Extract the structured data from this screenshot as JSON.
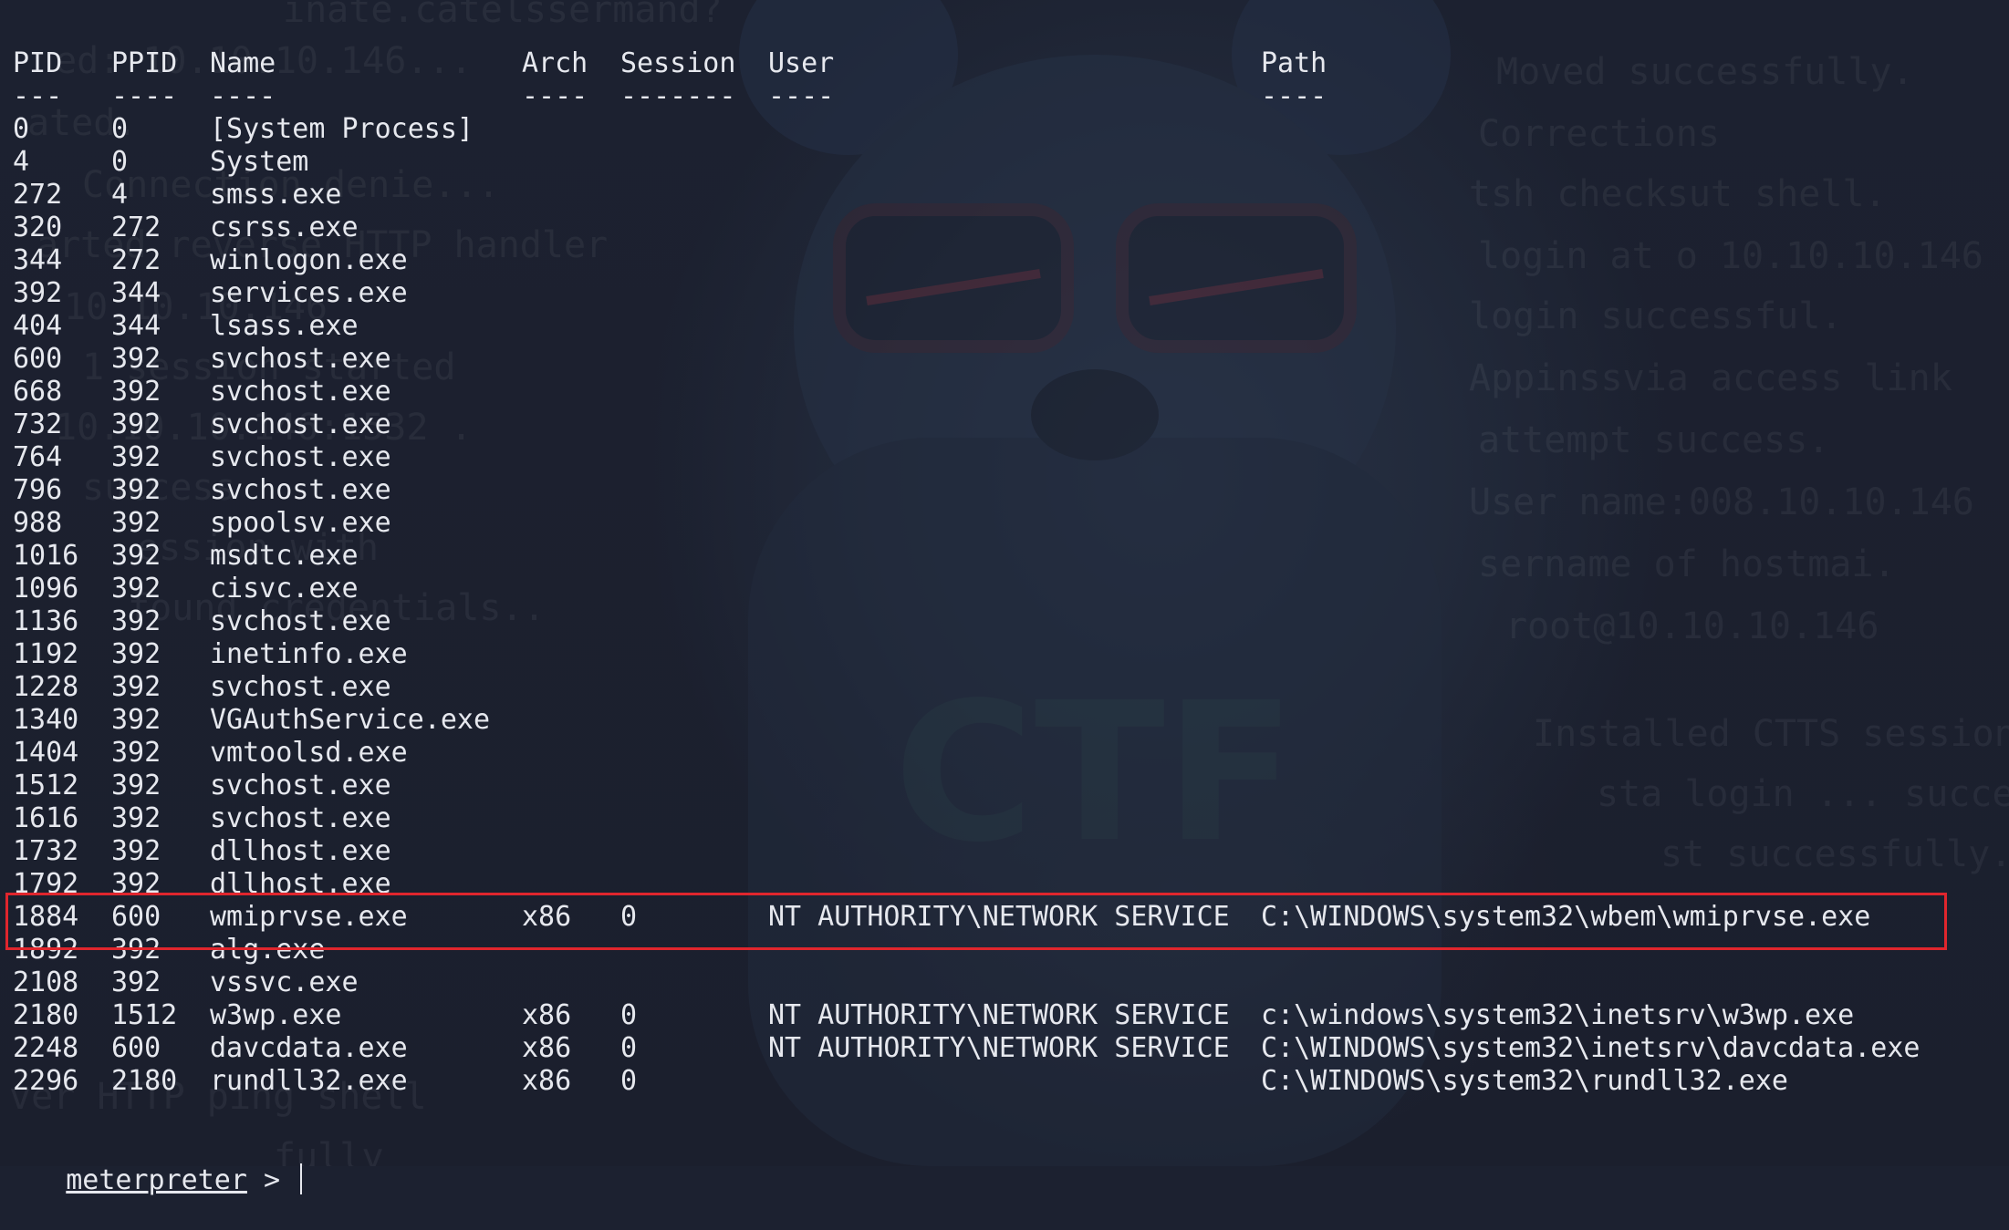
{
  "terminal": {
    "top_rule": "--------------",
    "headers": {
      "pid": "PID",
      "ppid": "PPID",
      "name": "Name",
      "arch": "Arch",
      "session": "Session",
      "user": "User",
      "path": "Path"
    },
    "underlines": {
      "pid": "---",
      "ppid": "----",
      "name": "----",
      "arch": "----",
      "session": "-------",
      "user": "----",
      "path": "----"
    },
    "rows": [
      {
        "pid": "0",
        "ppid": "0",
        "name": "[System Process]",
        "arch": "",
        "session": "",
        "user": "",
        "path": ""
      },
      {
        "pid": "4",
        "ppid": "0",
        "name": "System",
        "arch": "",
        "session": "",
        "user": "",
        "path": ""
      },
      {
        "pid": "272",
        "ppid": "4",
        "name": "smss.exe",
        "arch": "",
        "session": "",
        "user": "",
        "path": ""
      },
      {
        "pid": "320",
        "ppid": "272",
        "name": "csrss.exe",
        "arch": "",
        "session": "",
        "user": "",
        "path": ""
      },
      {
        "pid": "344",
        "ppid": "272",
        "name": "winlogon.exe",
        "arch": "",
        "session": "",
        "user": "",
        "path": ""
      },
      {
        "pid": "392",
        "ppid": "344",
        "name": "services.exe",
        "arch": "",
        "session": "",
        "user": "",
        "path": ""
      },
      {
        "pid": "404",
        "ppid": "344",
        "name": "lsass.exe",
        "arch": "",
        "session": "",
        "user": "",
        "path": ""
      },
      {
        "pid": "600",
        "ppid": "392",
        "name": "svchost.exe",
        "arch": "",
        "session": "",
        "user": "",
        "path": ""
      },
      {
        "pid": "668",
        "ppid": "392",
        "name": "svchost.exe",
        "arch": "",
        "session": "",
        "user": "",
        "path": ""
      },
      {
        "pid": "732",
        "ppid": "392",
        "name": "svchost.exe",
        "arch": "",
        "session": "",
        "user": "",
        "path": ""
      },
      {
        "pid": "764",
        "ppid": "392",
        "name": "svchost.exe",
        "arch": "",
        "session": "",
        "user": "",
        "path": ""
      },
      {
        "pid": "796",
        "ppid": "392",
        "name": "svchost.exe",
        "arch": "",
        "session": "",
        "user": "",
        "path": ""
      },
      {
        "pid": "988",
        "ppid": "392",
        "name": "spoolsv.exe",
        "arch": "",
        "session": "",
        "user": "",
        "path": ""
      },
      {
        "pid": "1016",
        "ppid": "392",
        "name": "msdtc.exe",
        "arch": "",
        "session": "",
        "user": "",
        "path": ""
      },
      {
        "pid": "1096",
        "ppid": "392",
        "name": "cisvc.exe",
        "arch": "",
        "session": "",
        "user": "",
        "path": ""
      },
      {
        "pid": "1136",
        "ppid": "392",
        "name": "svchost.exe",
        "arch": "",
        "session": "",
        "user": "",
        "path": ""
      },
      {
        "pid": "1192",
        "ppid": "392",
        "name": "inetinfo.exe",
        "arch": "",
        "session": "",
        "user": "",
        "path": ""
      },
      {
        "pid": "1228",
        "ppid": "392",
        "name": "svchost.exe",
        "arch": "",
        "session": "",
        "user": "",
        "path": ""
      },
      {
        "pid": "1340",
        "ppid": "392",
        "name": "VGAuthService.exe",
        "arch": "",
        "session": "",
        "user": "",
        "path": ""
      },
      {
        "pid": "1404",
        "ppid": "392",
        "name": "vmtoolsd.exe",
        "arch": "",
        "session": "",
        "user": "",
        "path": ""
      },
      {
        "pid": "1512",
        "ppid": "392",
        "name": "svchost.exe",
        "arch": "",
        "session": "",
        "user": "",
        "path": ""
      },
      {
        "pid": "1616",
        "ppid": "392",
        "name": "svchost.exe",
        "arch": "",
        "session": "",
        "user": "",
        "path": ""
      },
      {
        "pid": "1732",
        "ppid": "392",
        "name": "dllhost.exe",
        "arch": "",
        "session": "",
        "user": "",
        "path": ""
      },
      {
        "pid": "1792",
        "ppid": "392",
        "name": "dllhost.exe",
        "arch": "",
        "session": "",
        "user": "",
        "path": ""
      },
      {
        "pid": "1884",
        "ppid": "600",
        "name": "wmiprvse.exe",
        "arch": "x86",
        "session": "0",
        "user": "NT AUTHORITY\\NETWORK SERVICE",
        "path": "C:\\WINDOWS\\system32\\wbem\\wmiprvse.exe"
      },
      {
        "pid": "1892",
        "ppid": "392",
        "name": "alg.exe",
        "arch": "",
        "session": "",
        "user": "",
        "path": ""
      },
      {
        "pid": "2108",
        "ppid": "392",
        "name": "vssvc.exe",
        "arch": "",
        "session": "",
        "user": "",
        "path": ""
      },
      {
        "pid": "2180",
        "ppid": "1512",
        "name": "w3wp.exe",
        "arch": "x86",
        "session": "0",
        "user": "NT AUTHORITY\\NETWORK SERVICE",
        "path": "c:\\windows\\system32\\inetsrv\\w3wp.exe"
      },
      {
        "pid": "2248",
        "ppid": "600",
        "name": "davcdata.exe",
        "arch": "x86",
        "session": "0",
        "user": "NT AUTHORITY\\NETWORK SERVICE",
        "path": "C:\\WINDOWS\\system32\\inetsrv\\davcdata.exe"
      },
      {
        "pid": "2296",
        "ppid": "2180",
        "name": "rundll32.exe",
        "arch": "x86",
        "session": "0",
        "user": "",
        "path": "C:\\WINDOWS\\system32\\rundll32.exe"
      }
    ],
    "prompt": {
      "label": "meterpreter",
      "symbol": " > "
    }
  },
  "background": {
    "watermark_text": "CTF",
    "faded_lines_left": [
      "inate.catelssermand?",
      "ed: 10.10.10.146...",
      "ated.",
      "Connection denie...",
      "arted reverse HTTP handler",
      "10.10.10.146",
      "1 session started",
      "10.10.10.146:1532 .",
      "success",
      "ession with",
      "found credentials.."
    ],
    "faded_lines_right": [
      "Moved successfully.",
      "Corrections",
      "tsh checksut shell.",
      "login at o 10.10.10.146",
      "login successful.",
      "Appinssvia access link",
      "attempt success.",
      "User name:008.10.10.146",
      "sername of hostmai.",
      "root@10.10.10.146",
      "Installed CTTS session",
      "sta login ... success",
      "st successfully.",
      "ver HTTP ping shell",
      "fully"
    ],
    "colors": {
      "background": "#1c2130",
      "text": "#e6e8ee",
      "highlight_border": "#e0262d"
    }
  }
}
